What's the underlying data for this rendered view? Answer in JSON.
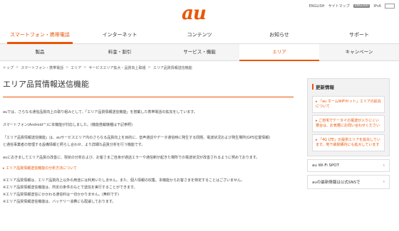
{
  "logo": "au",
  "util": {
    "english": "ENGLISH",
    "sitemap": "サイトマップ",
    "badge1": "ENGLISH",
    "badge2": "IPv6"
  },
  "gnav": [
    {
      "label": "スマートフォン・携帯電話"
    },
    {
      "label": "インターネット"
    },
    {
      "label": "コンテンツ"
    },
    {
      "label": "お知らせ"
    },
    {
      "label": "サポート"
    }
  ],
  "snav": [
    {
      "label": "製品"
    },
    {
      "label": "料金・割引"
    },
    {
      "label": "サービス・機能"
    },
    {
      "label": "エリア"
    },
    {
      "label": "キャンペーン"
    }
  ],
  "breadcrumb": [
    "トップ",
    "スマートフォン・携帯電話",
    "エリア",
    "サービスエリア拡大・品質向上取組",
    "エリア品質情報送信機能"
  ],
  "title": "エリア品質情報送信機能",
  "paragraphs": {
    "p1": "auでは、さらなる通信品質向上の取り組みとして、「エリア品質情報送信機能」を搭載した携帯電話の拡充をしています。",
    "p2": "スマートフォン(Android™)に本機能が対応しました。(機能搭載機種は下記参照)",
    "p3a": "「エリア品質情報送信機能」は、auサービスエリア内のさらなる品質向上を目的に、音声通話やデータ通信時に発生する問題、電波状況および発生場所(GPS位置情報)",
    "p3b": "と通信事業者の管理する設備情報と照らし合わせ、より詳細な品質分析を行う機能です。",
    "p4": "auにおきましてエリア品質の改善に、現状の分析および、お客さまご自身が通話エラーや通信断が起きた場所での電波状況が改善されるように努めております。",
    "link1": "エリア品質情報送信機能の分析方法について",
    "n1": "※エリア品質情報は、エリア品質向上以外の用途には利用いたしません。また、個人情報の収集、本機能からお客さまを特定することはございません。",
    "n2": "※エリア品質情報送信機能は、所定の条件のもとで送信を実行することができます。",
    "n3": "※エリア品質情報送信にかかわる通信料は一切かかりません。(無料です)",
    "n4": "※エリア品質情報送信機能は、バッテリー消費にも配慮しております。"
  },
  "side": {
    "panel_title": "更新情報",
    "news": [
      "「au ホームWiFiセット」エリアの拡充について",
      "ご自宅でケータイの電波が入りにくい場合は、お気軽にお問い合わせください",
      "「4G LTE」の提供エリアを拡充しています。地下鉄駅構内にも拡大しています"
    ],
    "wifi": "au Wi-Fi SPOT",
    "sns": "auの最新情報は公式SNSで"
  }
}
